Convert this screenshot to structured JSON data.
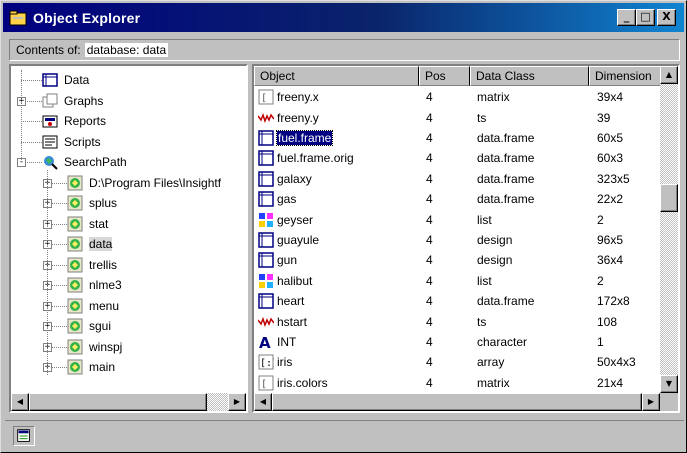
{
  "window": {
    "title": "Object Explorer",
    "buttons": {
      "minimize": "_",
      "maximize": "□",
      "close": "X"
    }
  },
  "contents": {
    "label": "Contents of:",
    "value": "database: data"
  },
  "tree": [
    {
      "label": "Data",
      "icon": "data-folder-icon",
      "level": 0,
      "expander": ""
    },
    {
      "label": "Graphs",
      "icon": "graphs-icon",
      "level": 0,
      "expander": "+"
    },
    {
      "label": "Reports",
      "icon": "reports-icon",
      "level": 0,
      "expander": ""
    },
    {
      "label": "Scripts",
      "icon": "scripts-icon",
      "level": 0,
      "expander": ""
    },
    {
      "label": "SearchPath",
      "icon": "searchpath-icon",
      "level": 0,
      "expander": "-"
    },
    {
      "label": "D:\\Program Files\\Insightf",
      "icon": "database-icon",
      "level": 1,
      "expander": "+"
    },
    {
      "label": "splus",
      "icon": "database-icon",
      "level": 1,
      "expander": "+"
    },
    {
      "label": "stat",
      "icon": "database-icon",
      "level": 1,
      "expander": "+"
    },
    {
      "label": "data",
      "icon": "database-icon",
      "level": 1,
      "expander": "+",
      "selected": true
    },
    {
      "label": "trellis",
      "icon": "database-icon",
      "level": 1,
      "expander": "+"
    },
    {
      "label": "nlme3",
      "icon": "database-icon",
      "level": 1,
      "expander": "+"
    },
    {
      "label": "menu",
      "icon": "database-icon",
      "level": 1,
      "expander": "+"
    },
    {
      "label": "sgui",
      "icon": "database-icon",
      "level": 1,
      "expander": "+"
    },
    {
      "label": "winspj",
      "icon": "database-icon",
      "level": 1,
      "expander": "+"
    },
    {
      "label": "main",
      "icon": "database-icon",
      "level": 1,
      "expander": "+"
    }
  ],
  "columns": [
    "Object",
    "Pos",
    "Data Class",
    "Dimension"
  ],
  "rows": [
    {
      "name": "freeny.x",
      "pos": "4",
      "cls": "matrix",
      "dim": "39x4",
      "icon": "matrix-icon"
    },
    {
      "name": "freeny.y",
      "pos": "4",
      "cls": "ts",
      "dim": "39",
      "icon": "ts-icon"
    },
    {
      "name": "fuel.frame",
      "pos": "4",
      "cls": "data.frame",
      "dim": "60x5",
      "icon": "dataframe-icon",
      "selected": true
    },
    {
      "name": "fuel.frame.orig",
      "pos": "4",
      "cls": "data.frame",
      "dim": "60x3",
      "icon": "dataframe-icon"
    },
    {
      "name": "galaxy",
      "pos": "4",
      "cls": "data.frame",
      "dim": "323x5",
      "icon": "dataframe-icon"
    },
    {
      "name": "gas",
      "pos": "4",
      "cls": "data.frame",
      "dim": "22x2",
      "icon": "dataframe-icon"
    },
    {
      "name": "geyser",
      "pos": "4",
      "cls": "list",
      "dim": "2",
      "icon": "list-icon"
    },
    {
      "name": "guayule",
      "pos": "4",
      "cls": "design",
      "dim": "96x5",
      "icon": "dataframe-icon"
    },
    {
      "name": "gun",
      "pos": "4",
      "cls": "design",
      "dim": "36x4",
      "icon": "dataframe-icon"
    },
    {
      "name": "halibut",
      "pos": "4",
      "cls": "list",
      "dim": "2",
      "icon": "list-icon"
    },
    {
      "name": "heart",
      "pos": "4",
      "cls": "data.frame",
      "dim": "172x8",
      "icon": "dataframe-icon"
    },
    {
      "name": "hstart",
      "pos": "4",
      "cls": "ts",
      "dim": "108",
      "icon": "ts-icon"
    },
    {
      "name": "INT",
      "pos": "4",
      "cls": "character",
      "dim": "1",
      "icon": "character-icon"
    },
    {
      "name": "iris",
      "pos": "4",
      "cls": "array",
      "dim": "50x4x3",
      "icon": "array-icon"
    },
    {
      "name": "iris.colors",
      "pos": "4",
      "cls": "matrix",
      "dim": "21x4",
      "icon": "matrix-icon"
    }
  ],
  "scroll": {
    "up": "▲",
    "down": "▼",
    "left": "◀",
    "right": "▶"
  }
}
